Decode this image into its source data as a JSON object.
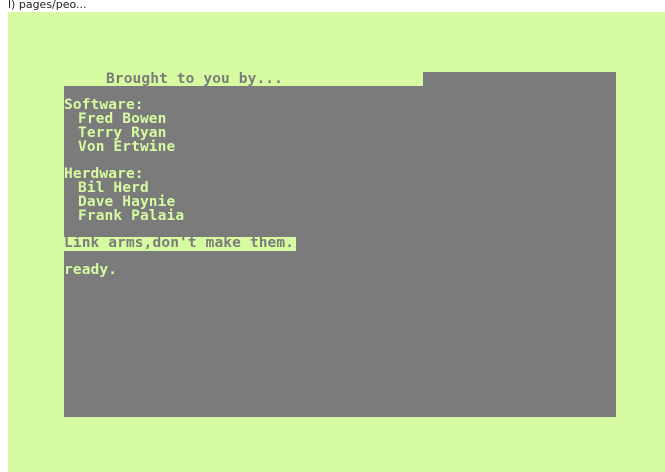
{
  "caption": "l) pages/peo...",
  "colors": {
    "border": "#d6fba0",
    "screen": "#7b7b7b",
    "text": "#d6fba0"
  },
  "screen": {
    "title": "Brought to you by...",
    "software_header": "Software:",
    "software": [
      "Fred Bowen",
      "Terry Ryan",
      "Von Ertwine"
    ],
    "hardware_header": "Herdware:",
    "hardware": [
      "Bil Herd",
      "Dave Haynie",
      "Frank Palaia"
    ],
    "motto": "Link arms,don't make them.",
    "prompt": "ready."
  }
}
